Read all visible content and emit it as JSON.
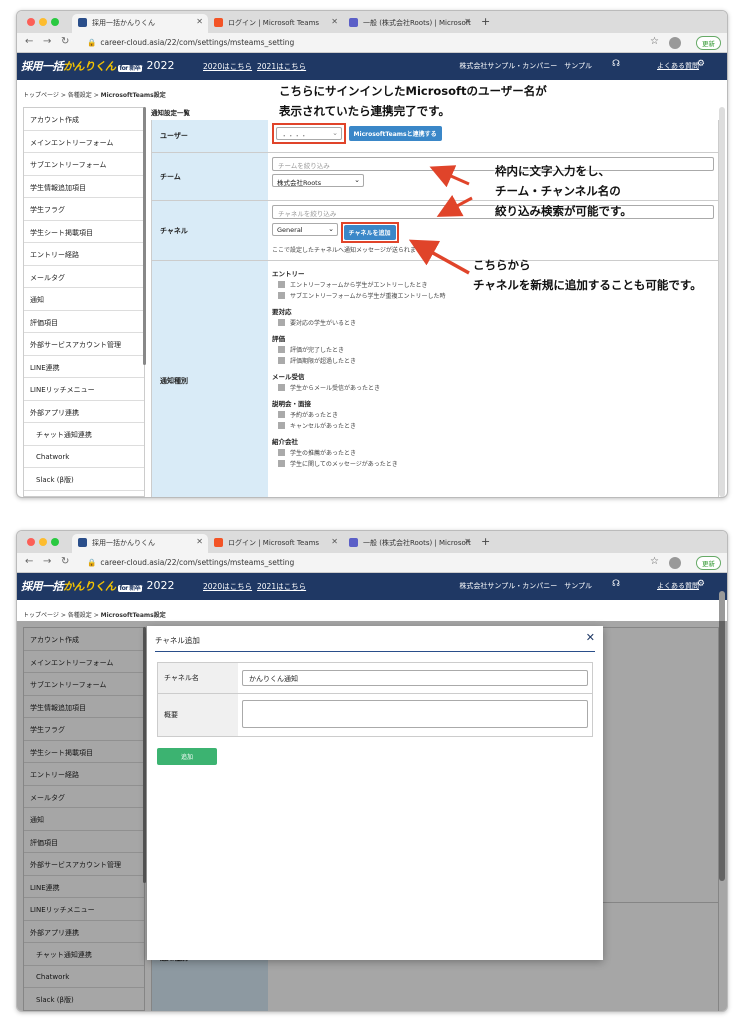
{
  "browser": {
    "tabs": [
      {
        "title": "採用一括かんりくん",
        "favicon_color": "#2a4e8a"
      },
      {
        "title": "ログイン | Microsoft Teams",
        "favicon_color": "#f35325"
      },
      {
        "title": "一般 (株式会社Roots) | Microsoft",
        "favicon_color": "#5b5fc7"
      }
    ],
    "url": "career-cloud.asia/22/com/settings/msteams_setting",
    "url_host": "career-cloud.asia",
    "update_label": "更新"
  },
  "app": {
    "logo_a": "採用一括",
    "logo_b": "かんりくん",
    "logo_tag": "for 新卒",
    "year": "- 2022",
    "link_2020": "2020はこちら",
    "link_2021": "2021はこちら",
    "company": "株式会社サンプル・カンパニー　サンプル",
    "faq": "よくある質問"
  },
  "breadcrumb": {
    "top": "トップページ",
    "sep": ">",
    "settings": "各種設定",
    "current": "MicrosoftTeams設定"
  },
  "sidebar": {
    "items": [
      "アカウント作成",
      "メインエントリーフォーム",
      "サブエントリーフォーム",
      "学生情報追加項目",
      "学生フラグ",
      "学生シート掲載項目",
      "エントリー経路",
      "メールタグ",
      "通知",
      "評価項目",
      "外部サービスアカウント管理",
      "LINE連携",
      "LINEリッチメニュー",
      "外部アプリ連携",
      "チャット通知連携",
      "Chatwork",
      "Slack (β版)"
    ]
  },
  "settings": {
    "section_title": "通知設定一覧",
    "user_label": "ユーザー",
    "user_value": "・・・・",
    "connect_button": "MicrosoftTeamsと連携する",
    "team_label": "チーム",
    "team_filter_placeholder": "チームを絞り込み",
    "team_value": "株式会社Roots",
    "channel_label": "チャネル",
    "channel_filter_placeholder": "チャネルを絞り込み",
    "channel_value": "General",
    "add_channel_button": "チャネルを追加",
    "channel_note": "ここで設定したチャネルへ通知メッセージが送られます。",
    "notify_label": "通知種別",
    "groups": [
      {
        "title": "エントリー",
        "items": [
          "エントリーフォームから学生がエントリーしたとき",
          "サブエントリーフォームから学生が重複エントリーした時"
        ]
      },
      {
        "title": "要対応",
        "items": [
          "要対応の学生がいるとき"
        ]
      },
      {
        "title": "評価",
        "items": [
          "評価が完了したとき",
          "評価期限が超過したとき"
        ]
      },
      {
        "title": "メール受信",
        "items": [
          "学生からメール受信があったとき"
        ]
      },
      {
        "title": "説明会・面接",
        "items": [
          "予約があったとき",
          "キャンセルがあったとき"
        ]
      },
      {
        "title": "紹介会社",
        "items": [
          "学生の推薦があったとき",
          "学生に関してのメッセージがあったとき"
        ]
      }
    ]
  },
  "annotations": {
    "a1_line1": "こちらにサインインしたMicrosoftのユーザー名が",
    "a1_line2": "表示されていたら連携完了です。",
    "a2_line1": "枠内に文字入力をし、",
    "a2_line2": "チーム・チャンネル名の",
    "a2_line3": "絞り込み検索が可能です。",
    "a3_line1": "こちらから",
    "a3_line2": "チャネルを新規に追加することも可能です。",
    "arrow_color": "#e0442a"
  },
  "modal": {
    "title": "チャネル追加",
    "close_icon": "close-icon",
    "name_label": "チャネル名",
    "name_value": "かんりくん通知",
    "summary_label": "概要",
    "summary_value": "",
    "submit_label": "追加"
  },
  "colors": {
    "header": "#1f3864",
    "label_bg": "#d9ebf7",
    "button": "#3a87c8",
    "submit": "#3cb371",
    "highlight": "#e0442a"
  }
}
